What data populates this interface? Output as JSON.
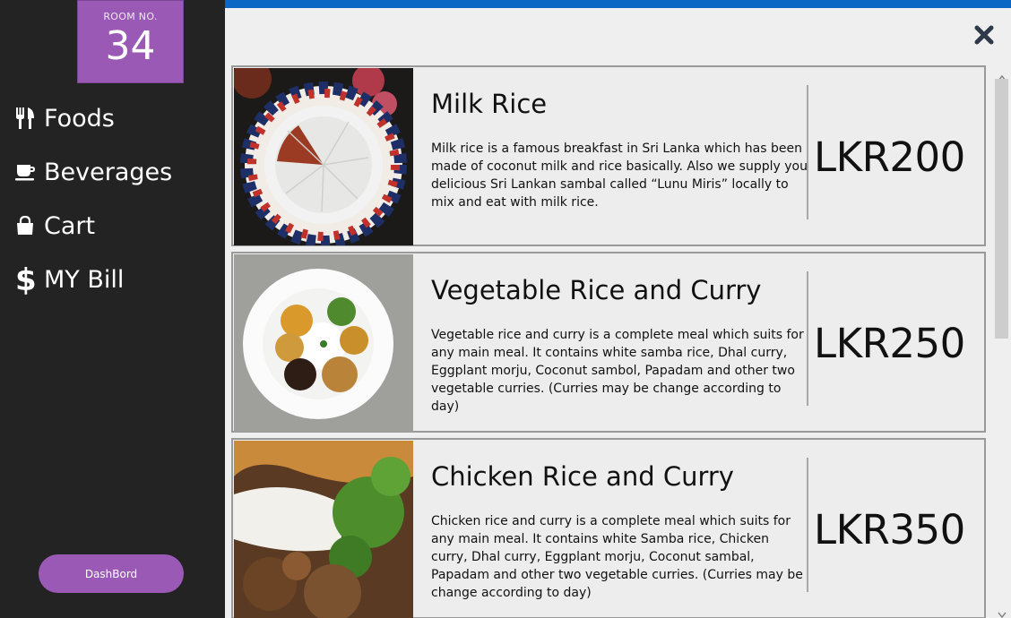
{
  "room": {
    "label": "ROOM NO.",
    "number": "34"
  },
  "nav": {
    "foods": "Foods",
    "beverages": "Beverages",
    "cart": "Cart",
    "bill": "MY Bill"
  },
  "dashboard_label": "DashBord",
  "colors": {
    "accent": "#9b59b6",
    "topbar": "#0a68c4",
    "sidebar": "#232323"
  },
  "menu": [
    {
      "title": "Milk Rice",
      "description": "Milk rice is a famous breakfast in Sri Lanka which has been made of coconut milk and rice basically. Also we supply you delicious Sri Lankan sambal called “Lunu Miris” locally to mix and eat with milk rice.",
      "price": "LKR200",
      "image": "milk-rice-photo"
    },
    {
      "title": "Vegetable Rice and Curry",
      "description": "Vegetable rice and curry is a complete meal which suits for any main meal. It contains white samba rice, Dhal curry, Eggplant morju, Coconut sambol, Papadam and other two vegetable curries. (Curries may be change according to day)",
      "price": "LKR250",
      "image": "vegetable-rice-photo"
    },
    {
      "title": "Chicken Rice and Curry",
      "description": "Chicken rice and curry is a complete meal which suits for any main meal. It contains white Samba rice, Chicken curry, Dhal curry, Eggplant morju, Coconut sambal, Papadam and other two vegetable curries. (Curries may be change according to day)",
      "price": "LKR350",
      "image": "chicken-rice-photo"
    }
  ]
}
